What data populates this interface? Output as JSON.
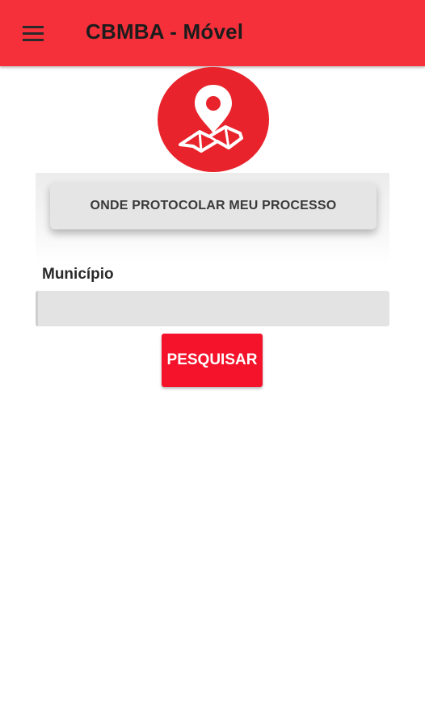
{
  "app_bar": {
    "title": "CBMBA - Móvel",
    "menu_icon": "hamburger-menu-icon",
    "background": "#f5303a"
  },
  "logo": {
    "icon": "map-pin-icon",
    "background": "#e8232b"
  },
  "section_button": {
    "label": "ONDE PROTOCOLAR MEU PROCESSO"
  },
  "form": {
    "municipio_label": "Município",
    "municipio_value": "",
    "search_label": "PESQUISAR"
  }
}
